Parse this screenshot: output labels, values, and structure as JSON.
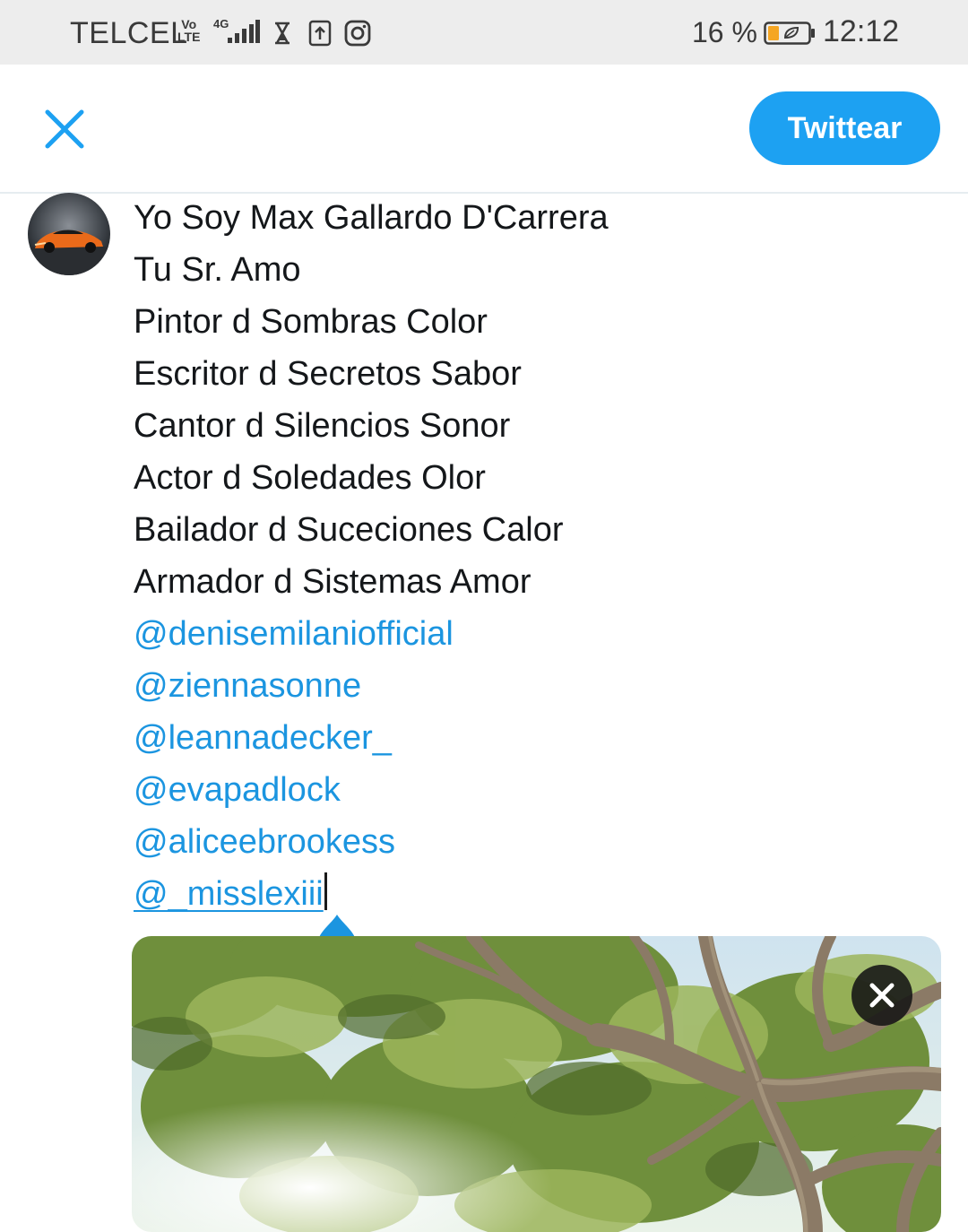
{
  "status_bar": {
    "carrier": "TELCEL",
    "volte_top": "Vo",
    "volte_bottom": "LTE",
    "network": "4G",
    "battery_percent": "16 %",
    "time": "12:12",
    "icons": [
      "volte-icon",
      "signal-icon",
      "hourglass-icon",
      "upload-icon",
      "instagram-icon",
      "battery-icon"
    ]
  },
  "header": {
    "close_icon": "close-icon",
    "tweet_button_label": "Twittear"
  },
  "colors": {
    "brand_blue": "#1da1f2",
    "mention_blue": "#1b95e0",
    "text": "#14171a",
    "status_bar_bg": "#ededed"
  },
  "tweet": {
    "lines": [
      "Yo Soy Max Gallardo D'Carrera",
      "Tu Sr. Amo",
      "Pintor d Sombras Color",
      "Escritor d Secretos Sabor",
      "Cantor d Silencios Sonor",
      "Actor d Soledades Olor",
      "Bailador d Suceciones Calor",
      "Armador d Sistemas Amor"
    ],
    "mentions": [
      "@denisemilaniofficial",
      "@ziennasonne",
      "@leannadecker_",
      "@evapadlock",
      "@aliceebrookess"
    ],
    "active_mention": "@_misslexiii"
  },
  "attachment": {
    "remove_icon": "close-icon"
  }
}
